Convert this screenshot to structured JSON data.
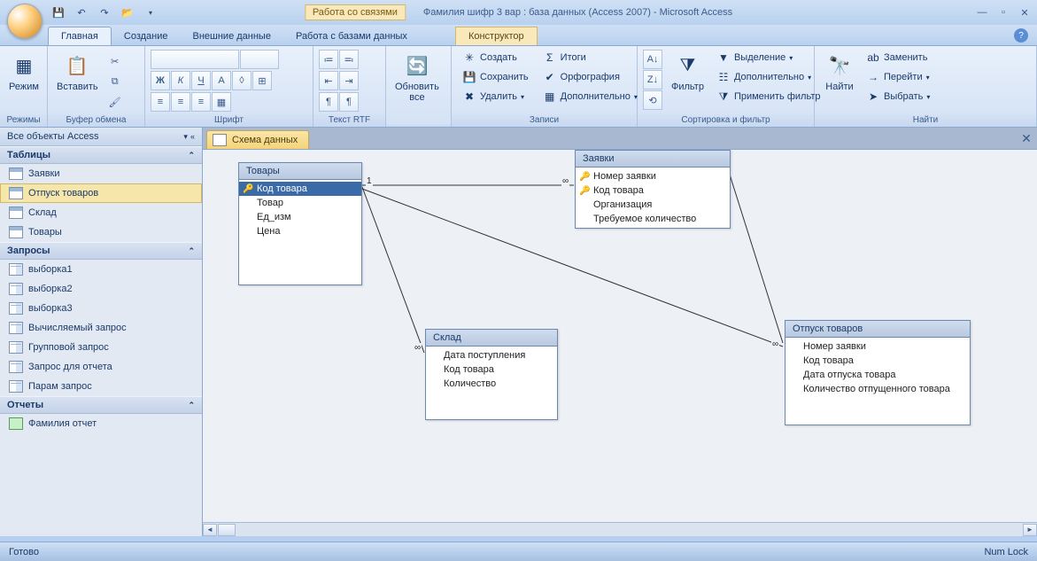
{
  "titlebar": {
    "context_label": "Работа со связями",
    "app_title": "Фамилия шифр 3 вар : база данных (Access 2007) - Microsoft Access"
  },
  "tabs": {
    "main": "Главная",
    "create": "Создание",
    "external": "Внешние данные",
    "dbtools": "Работа с базами данных",
    "designer": "Конструктор"
  },
  "ribbon": {
    "group_modes": "Режимы",
    "mode_btn": "Режим",
    "group_clipboard": "Буфер обмена",
    "paste_btn": "Вставить",
    "group_font": "Шрифт",
    "group_rtf": "Текст RTF",
    "group_records": "Записи",
    "refresh_btn": "Обновить\nвсе",
    "rec_create": "Создать",
    "rec_save": "Сохранить",
    "rec_delete": "Удалить",
    "rec_totals": "Итоги",
    "rec_spell": "Орфография",
    "rec_more": "Дополнительно",
    "group_sort": "Сортировка и фильтр",
    "filter_btn": "Фильтр",
    "sf_selection": "Выделение",
    "sf_advanced": "Дополнительно",
    "sf_toggle": "Применить фильтр",
    "group_find": "Найти",
    "find_btn": "Найти",
    "f_replace": "Заменить",
    "f_goto": "Перейти",
    "f_select": "Выбрать"
  },
  "nav": {
    "header": "Все объекты Access",
    "sec_tables": "Таблицы",
    "t1": "Заявки",
    "t2": "Отпуск товаров",
    "t3": "Склад",
    "t4": "Товары",
    "sec_queries": "Запросы",
    "q1": "выборка1",
    "q2": "выборка2",
    "q3": "выборка3",
    "q4": "Вычисляемый запрос",
    "q5": "Групповой запрос",
    "q6": "Запрос для отчета",
    "q7": "Парам запрос",
    "sec_reports": "Отчеты",
    "r1": "Фамилия отчет"
  },
  "doc": {
    "tab_title": "Схема данных",
    "tables": {
      "tovary": {
        "title": "Товары",
        "f1": "Код товара",
        "f2": "Товар",
        "f3": "Ед_изм",
        "f4": "Цена"
      },
      "zayavki": {
        "title": "Заявки",
        "f1": "Номер заявки",
        "f2": "Код товара",
        "f3": "Организация",
        "f4": "Требуемое количество"
      },
      "sklad": {
        "title": "Склад",
        "f1": "Дата поступления",
        "f2": "Код товара",
        "f3": "Количество"
      },
      "otpusk": {
        "title": "Отпуск товаров",
        "f1": "Номер заявки",
        "f2": "Код товара",
        "f3": "Дата отпуска товара",
        "f4": "Количество отпущенного товара"
      }
    },
    "rel": {
      "one": "1",
      "many": "∞"
    }
  },
  "status": {
    "ready": "Готово",
    "numlock": "Num Lock"
  }
}
